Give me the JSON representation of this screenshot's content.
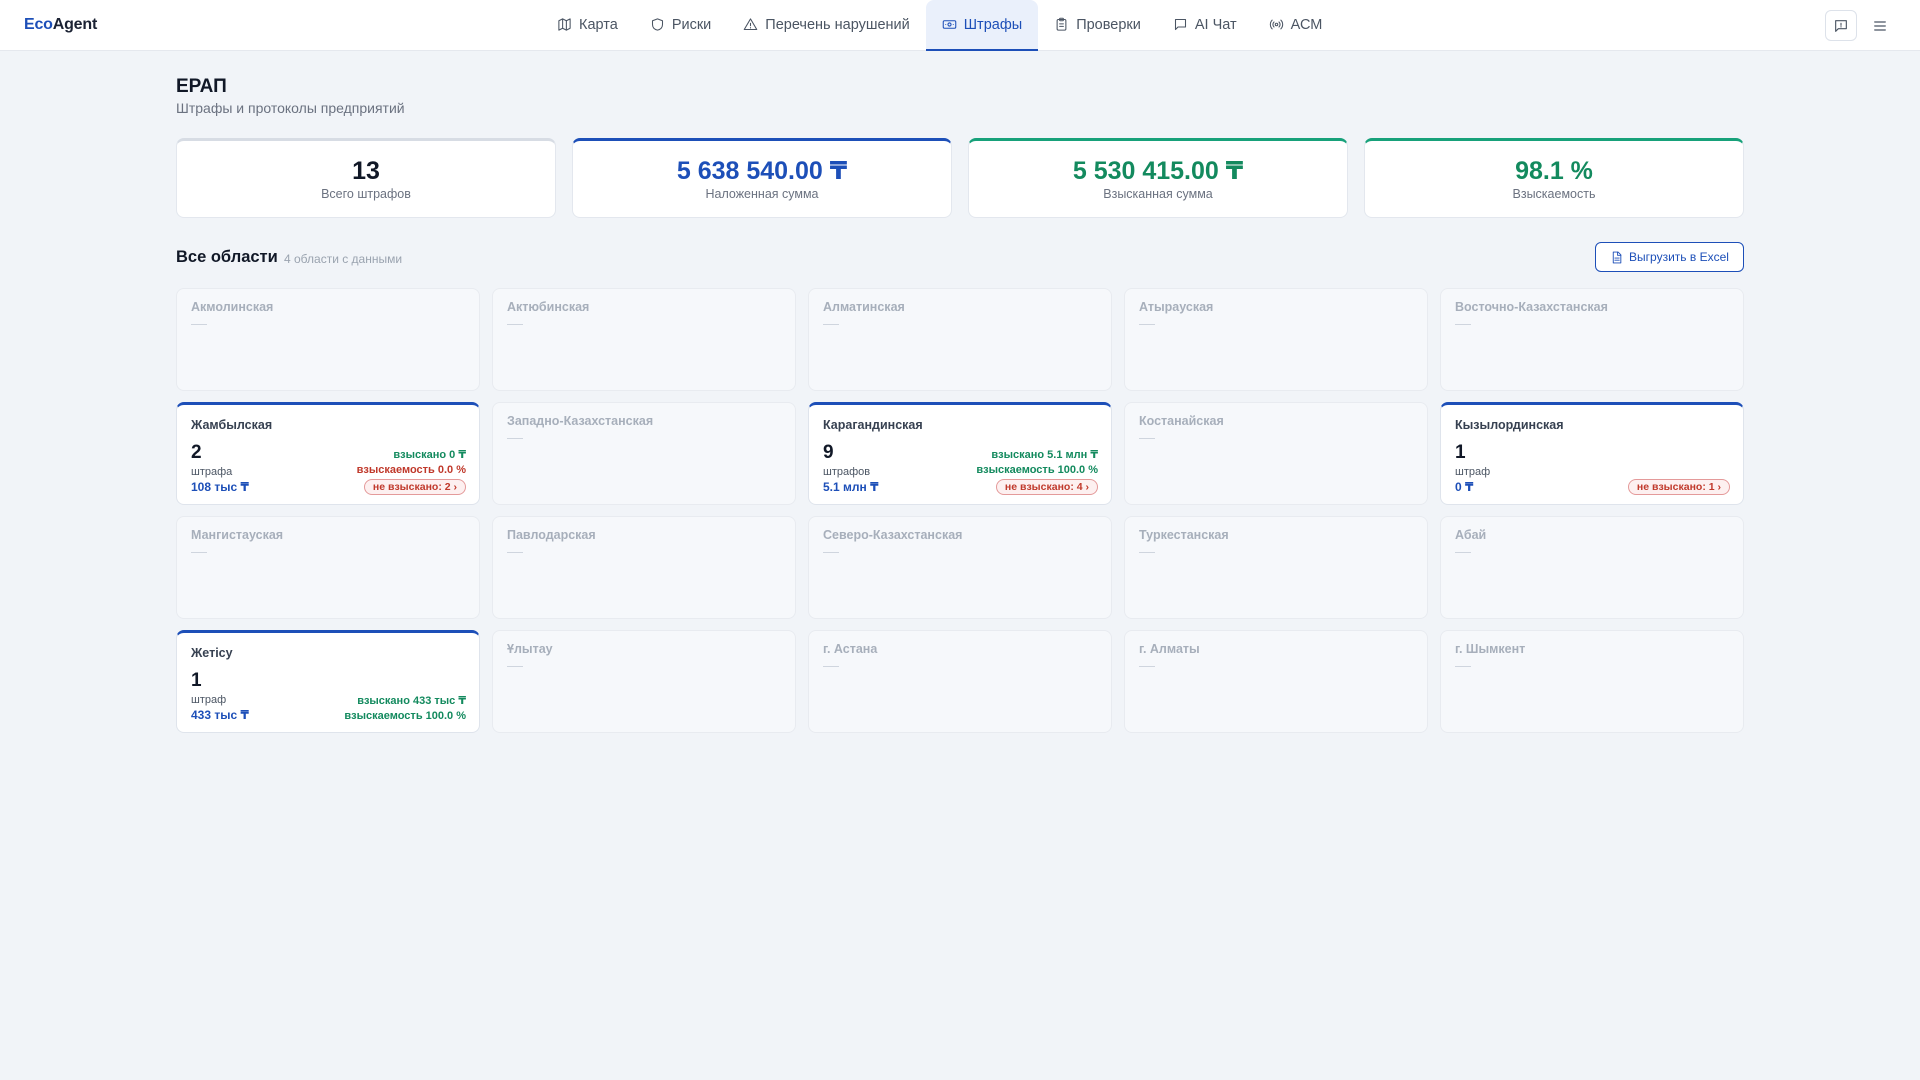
{
  "app": {
    "logo_part1": "Eco",
    "logo_part2": "Agent"
  },
  "nav": {
    "items": [
      {
        "label": "Карта",
        "icon": "map-icon"
      },
      {
        "label": "Риски",
        "icon": "shield-icon"
      },
      {
        "label": "Перечень нарушений",
        "icon": "warning-icon"
      },
      {
        "label": "Штрафы",
        "icon": "banknote-icon",
        "active": true
      },
      {
        "label": "Проверки",
        "icon": "clipboard-icon"
      },
      {
        "label": "AI Чат",
        "icon": "chat-icon"
      },
      {
        "label": "АСМ",
        "icon": "broadcast-icon"
      }
    ]
  },
  "page": {
    "title": "ЕРАП",
    "subtitle": "Штрафы и протоколы предприятий"
  },
  "stats": [
    {
      "value": "13",
      "label": "Всего штрафов"
    },
    {
      "value": "5 638 540.00 ₸",
      "label": "Наложенная сумма"
    },
    {
      "value": "5 530 415.00 ₸",
      "label": "Взысканная сумма"
    },
    {
      "value": "98.1 %",
      "label": "Взыскаемость"
    }
  ],
  "section": {
    "title": "Все области",
    "meta": "4 области с данными",
    "export_label": "Выгрузить в Excel"
  },
  "colors": {
    "accent": "#1d4fb8",
    "success": "#138a5e",
    "danger": "#c0392b"
  },
  "regions": {
    "akmola": {
      "name": "Акмолинская"
    },
    "aktobe": {
      "name": "Актюбинская"
    },
    "almaty_reg": {
      "name": "Алматинская"
    },
    "atyrau": {
      "name": "Атырауская"
    },
    "east_kz": {
      "name": "Восточно-Казахстанская"
    },
    "zhambyl": {
      "name": "Жамбылская",
      "count": "2",
      "unit": "штрафа",
      "sum": "108 тыс ₸",
      "collected": "взыскано 0 ₸",
      "rate": "взыскаемость 0.0 %",
      "badge": "не взыскано: 2 ›"
    },
    "west_kz": {
      "name": "Западно-Казахстанская"
    },
    "karaganda": {
      "name": "Карагандинская",
      "count": "9",
      "unit": "штрафов",
      "sum": "5.1 млн ₸",
      "collected": "взыскано 5.1 млн ₸",
      "rate": "взыскаемость 100.0 %",
      "badge": "не взыскано: 4 ›"
    },
    "kostanay": {
      "name": "Костанайская"
    },
    "kyzylorda": {
      "name": "Кызылординская",
      "count": "1",
      "unit": "штраф",
      "sum": "0 ₸",
      "badge": "не взыскано: 1 ›"
    },
    "mangystau": {
      "name": "Мангистауская"
    },
    "pavlodar": {
      "name": "Павлодарская"
    },
    "north_kz": {
      "name": "Северо-Казахстанская"
    },
    "turkestan": {
      "name": "Туркестанская"
    },
    "abai": {
      "name": "Абай"
    },
    "zhetisu": {
      "name": "Жетісу",
      "count": "1",
      "unit": "штраф",
      "sum": "433 тыс ₸",
      "collected": "взыскано 433 тыс ₸",
      "rate": "взыскаемость 100.0 %"
    },
    "ulytau": {
      "name": "Ұлытау"
    },
    "astana": {
      "name": "г. Астана"
    },
    "almaty_city": {
      "name": "г. Алматы"
    },
    "shymkent": {
      "name": "г. Шымкент"
    }
  }
}
